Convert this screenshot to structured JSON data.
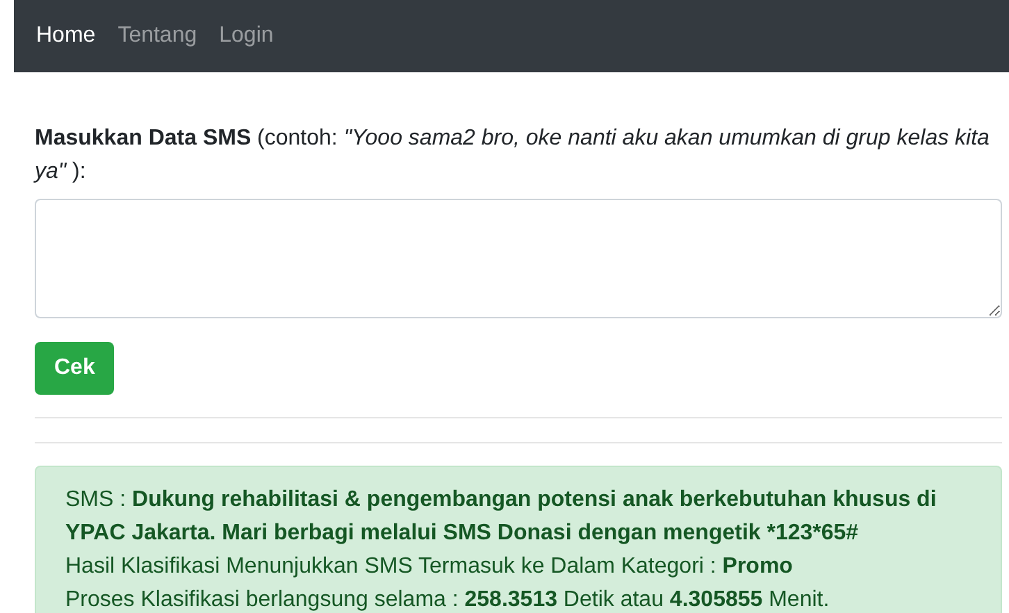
{
  "navbar": {
    "items": [
      {
        "label": "Home",
        "selected": true
      },
      {
        "label": "Tentang",
        "selected": false
      },
      {
        "label": "Login",
        "selected": false
      }
    ]
  },
  "form": {
    "label": "**Masukkan Data SMS** (contoh: *\"Yooo sama2 bro, oke nanti aku akan umumkan di grup kelas kita ya\"* ):",
    "button": "Cek"
  },
  "result": {
    "lines": [
      [
        {
          "text": "SMS : ",
          "bold": false
        },
        {
          "text": "Dukung rehabilitasi & pengembangan potensi anak berkebutuhan khusus di YPAC Jakarta. Mari berbagi melalui SMS Donasi dengan mengetik *123*65#",
          "bold": true
        }
      ],
      [
        {
          "text": "Hasil Klasifikasi Menunjukkan SMS Termasuk ke Dalam Kategori : ",
          "bold": false
        },
        {
          "text": "Promo",
          "bold": true
        }
      ],
      [
        {
          "text": "Proses Klasifikasi berlangsung selama : ",
          "bold": false
        },
        {
          "text": "258.3513",
          "bold": true
        },
        {
          "text": " Detik atau ",
          "bold": false
        },
        {
          "text": "4.305855",
          "bold": true
        },
        {
          "text": " Menit.",
          "bold": false
        }
      ]
    ]
  }
}
